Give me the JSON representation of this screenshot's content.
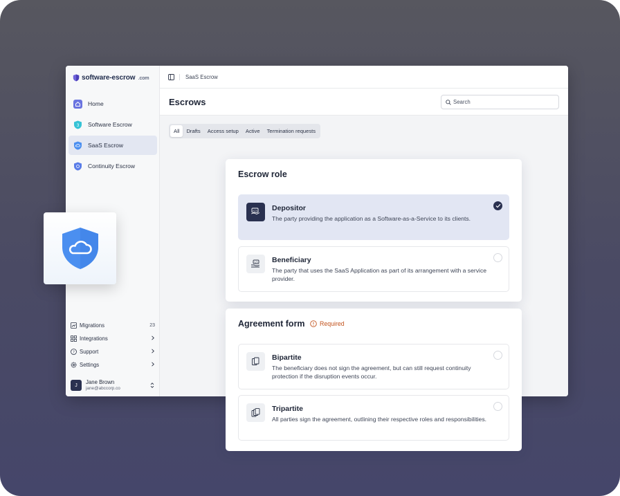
{
  "brand": {
    "name": "software-escrow",
    "tld": ".com"
  },
  "sidebar": {
    "items": [
      {
        "label": "Home",
        "icon": "home-icon",
        "active": false
      },
      {
        "label": "Software Escrow",
        "icon": "software-shield-icon",
        "active": false
      },
      {
        "label": "SaaS Escrow",
        "icon": "cloud-shield-icon",
        "active": true
      },
      {
        "label": "Continuity Escrow",
        "icon": "continuity-shield-icon",
        "active": false
      }
    ],
    "bottom": [
      {
        "label": "Migrations",
        "icon": "migrations-icon",
        "badge": "23"
      },
      {
        "label": "Integrations",
        "icon": "grid-icon",
        "badge": ""
      },
      {
        "label": "Support",
        "icon": "help-icon",
        "badge": ""
      },
      {
        "label": "Settings",
        "icon": "gear-icon",
        "badge": ""
      }
    ],
    "user": {
      "initial": "J",
      "name": "Jane Brown",
      "email": "jane@abccorp.co"
    }
  },
  "breadcrumb": "SaaS Escrow",
  "page_title": "Escrows",
  "search": {
    "placeholder": "Search",
    "value": ""
  },
  "tabs": [
    {
      "label": "All",
      "active": true
    },
    {
      "label": "Drafts",
      "active": false
    },
    {
      "label": "Access setup",
      "active": false
    },
    {
      "label": "Active",
      "active": false
    },
    {
      "label": "Termination requests",
      "active": false
    }
  ],
  "escrow_role": {
    "title": "Escrow role",
    "options": [
      {
        "title": "Depositor",
        "desc": "The party providing the application as a Software-as-a-Service to its clients.",
        "selected": true
      },
      {
        "title": "Beneficiary",
        "desc": "The party that uses the SaaS Application as part of its arrangement with a service provider.",
        "selected": false
      }
    ]
  },
  "agreement_form": {
    "title": "Agreement form",
    "required": "Required",
    "options": [
      {
        "title": "Bipartite",
        "desc": "The beneficiary does not sign the agreement, but can still request continuity protection if the disruption events occur.",
        "selected": false
      },
      {
        "title": "Tripartite",
        "desc": "All parties sign the agreement, outlining their respective roles and responsibilities.",
        "selected": false
      }
    ]
  },
  "colors": {
    "accent": "#2a3150",
    "selected_bg": "#e2e6f3",
    "shield_blue": "#4b8ff0",
    "required": "#c2521c"
  }
}
